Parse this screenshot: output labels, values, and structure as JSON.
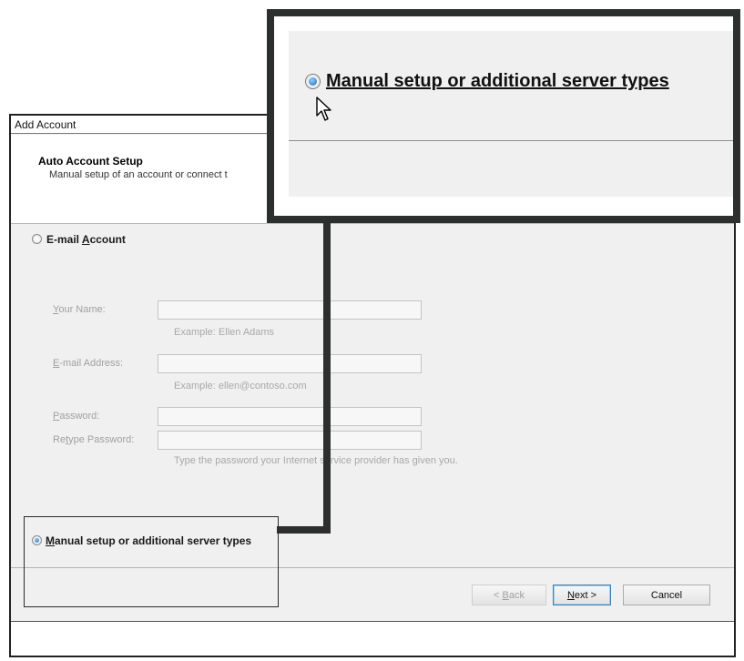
{
  "window": {
    "title": "Add Account"
  },
  "header": {
    "title": "Auto Account Setup",
    "subtitle": "Manual setup of an account or connect t"
  },
  "email_option": {
    "label_prefix": "E-mail ",
    "label_mnemonic": "A",
    "label_suffix": "ccount",
    "selected": false
  },
  "fields": [
    {
      "label_mnemonic": "Y",
      "label_rest": "our Name:",
      "value": "",
      "hint": "Example: Ellen Adams"
    },
    {
      "label_mnemonic": "E",
      "label_rest": "-mail Address:",
      "value": "",
      "hint": "Example: ellen@contoso.com"
    },
    {
      "label_mnemonic": "P",
      "label_rest": "assword:",
      "value": "",
      "hint": ""
    },
    {
      "label_prefix": "Re",
      "label_mnemonic": "t",
      "label_rest": "ype Password:",
      "value": "",
      "hint": "Type the password your Internet service provider has given you."
    }
  ],
  "manual_option": {
    "label_mnemonic": "M",
    "label_rest": "anual setup or additional server types",
    "selected": true
  },
  "buttons": {
    "back": {
      "prefix": "< ",
      "mnemonic": "B",
      "rest": "ack"
    },
    "next": {
      "mnemonic": "N",
      "rest": "ext >"
    },
    "cancel": "Cancel"
  },
  "zoom": {
    "label": "Manual setup or additional server types"
  },
  "icons": {
    "cursor": "arrow-cursor-icon",
    "radio": "radio-button-icon"
  },
  "colors": {
    "callout_border": "#2d2f2f",
    "dialog_bg": "#f0f0f0",
    "radio_accent": "#1f66b8"
  }
}
